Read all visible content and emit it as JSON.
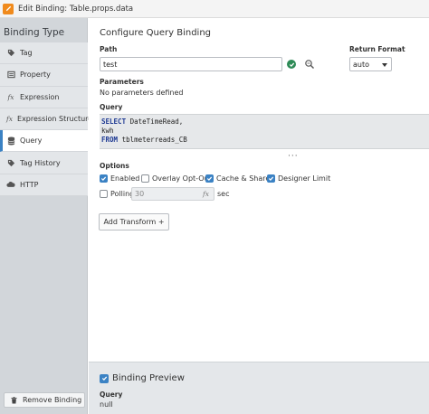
{
  "window": {
    "title": "Edit Binding: Table.props.data",
    "accent": "#f08a1c"
  },
  "sidebar": {
    "header": "Binding Type",
    "items": [
      {
        "label": "Tag",
        "icon": "tag-icon"
      },
      {
        "label": "Property",
        "icon": "property-icon"
      },
      {
        "label": "Expression",
        "icon": "fx-icon",
        "glyph": "fx"
      },
      {
        "label": "Expression Structure",
        "icon": "fx-structure-icon",
        "glyph": "fx"
      },
      {
        "label": "Query",
        "icon": "database-icon",
        "active": true
      },
      {
        "label": "Tag History",
        "icon": "tag-history-icon"
      },
      {
        "label": "HTTP",
        "icon": "cloud-icon"
      }
    ],
    "remove_button": "Remove Binding"
  },
  "main": {
    "title": "Configure Query Binding",
    "path_label": "Path",
    "path_value": "test",
    "return_format_label": "Return Format",
    "return_format_value": "auto",
    "parameters_label": "Parameters",
    "no_params_text": "No parameters defined",
    "query_label": "Query",
    "query_lines": [
      {
        "kw": "SELECT",
        "text": " DateTimeRead,"
      },
      {
        "kw": "",
        "text": "kwh"
      },
      {
        "kw": "FROM",
        "text": " tblmeterreads_CB"
      }
    ],
    "options_label": "Options",
    "options": {
      "enabled": {
        "label": "Enabled",
        "checked": true
      },
      "overlay_opt_out": {
        "label": "Overlay Opt-Out",
        "checked": false
      },
      "cache_share": {
        "label": "Cache & Share",
        "checked": true
      },
      "designer_limit": {
        "label": "Designer Limit",
        "checked": true
      },
      "polling": {
        "label": "Polling",
        "checked": false,
        "value": "30",
        "unit": "sec",
        "fx": "fx"
      }
    },
    "add_transform": "Add Transform +"
  },
  "preview": {
    "label": "Binding Preview",
    "checked": true,
    "query_label": "Query",
    "query_value": "null"
  },
  "colors": {
    "check_blue": "#3b82c4",
    "ok_green": "#2e8b57",
    "sidebar_bg": "#d2d6da"
  }
}
